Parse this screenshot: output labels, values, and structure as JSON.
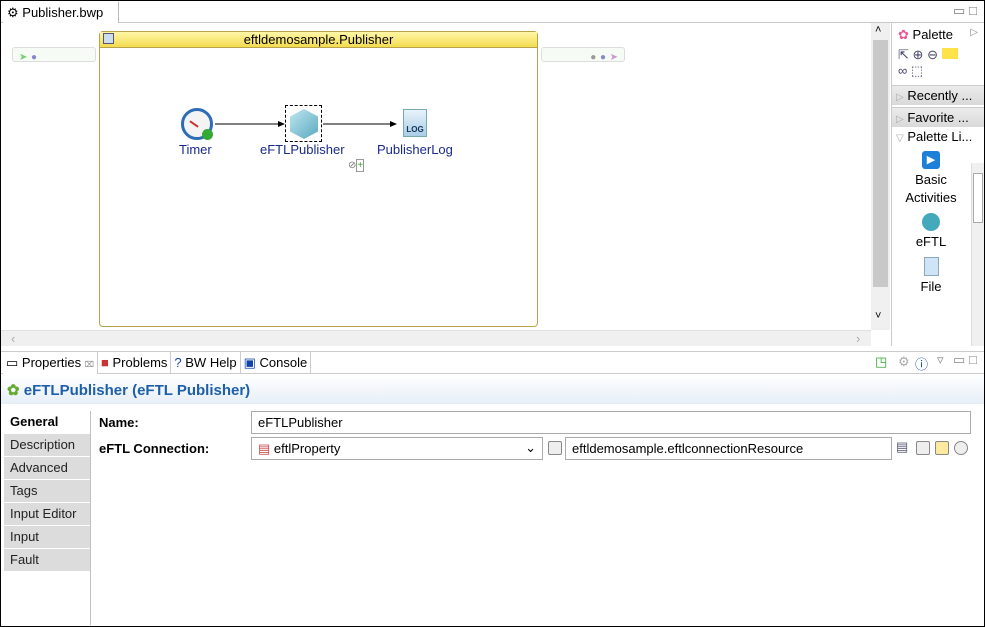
{
  "editor": {
    "tab_label": "Publisher.bwp",
    "close_glyph": "⌧"
  },
  "process": {
    "title": "eftldemosample.Publisher",
    "activities": [
      {
        "label": "Timer"
      },
      {
        "label": "eFTLPublisher"
      },
      {
        "label": "PublisherLog"
      }
    ],
    "log_glyph": "LOG"
  },
  "palette": {
    "title": "Palette",
    "drawers": [
      {
        "label": "Recently ..."
      },
      {
        "label": "Favorite ..."
      },
      {
        "label": "Palette Li..."
      }
    ],
    "items": [
      {
        "label": "Basic Activities"
      },
      {
        "label": "eFTL"
      },
      {
        "label": "File"
      }
    ]
  },
  "properties": {
    "tabs": [
      {
        "label": "Properties"
      },
      {
        "label": "Problems"
      },
      {
        "label": "BW Help"
      },
      {
        "label": "Console"
      }
    ],
    "title": "eFTLPublisher (eFTL Publisher)",
    "side_tabs": [
      {
        "label": "General"
      },
      {
        "label": "Description"
      },
      {
        "label": "Advanced"
      },
      {
        "label": "Tags"
      },
      {
        "label": "Input Editor"
      },
      {
        "label": "Input"
      },
      {
        "label": "Fault"
      }
    ],
    "fields": {
      "name_label": "Name:",
      "name_value": "eFTLPublisher",
      "conn_label": "eFTL Connection:",
      "conn_property": "eftlProperty",
      "conn_resource": "eftldemosample.eftlconnectionResource"
    }
  }
}
